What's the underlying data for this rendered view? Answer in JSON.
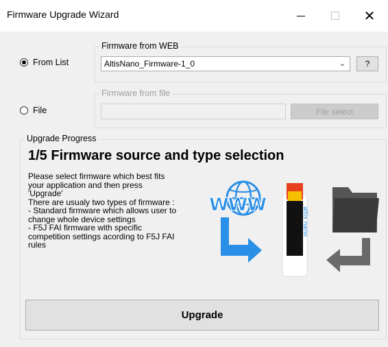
{
  "window": {
    "title": "Firmware Upgrade Wizard",
    "minimize_icon": "minimize-icon",
    "maximize_icon": "maximize-icon",
    "close_symbol": "✕"
  },
  "source": {
    "from_list_label": "From List",
    "from_list_selected": true,
    "file_label": "File",
    "file_selected": false
  },
  "web_group": {
    "legend": "Firmware from WEB",
    "selected_firmware": "AltisNano_Firmware-1_0",
    "help_label": "?"
  },
  "file_group": {
    "legend": "Firmware from file",
    "path_value": "",
    "file_select_label": "File select"
  },
  "progress": {
    "legend": "Upgrade Progress",
    "step_title": "1/5 Firmware source and type selection",
    "description_lines": [
      "Please select firmware which best fits",
      "your application and then press",
      "'Upgrade'",
      "There are usualy two types of firmware :",
      "- Standard firmware which allows user to",
      "change whole device settings",
      "- F5J FAI firmware with specific",
      "competition settings acording to F5J FAI",
      "rules"
    ],
    "illustration": {
      "web_text": "WWW",
      "device_text": "altis nano"
    }
  },
  "actions": {
    "upgrade_label": "Upgrade"
  },
  "colors": {
    "accent_blue": "#2a8fe6",
    "folder_gray": "#555555",
    "window_bg": "#f0f0f0"
  }
}
